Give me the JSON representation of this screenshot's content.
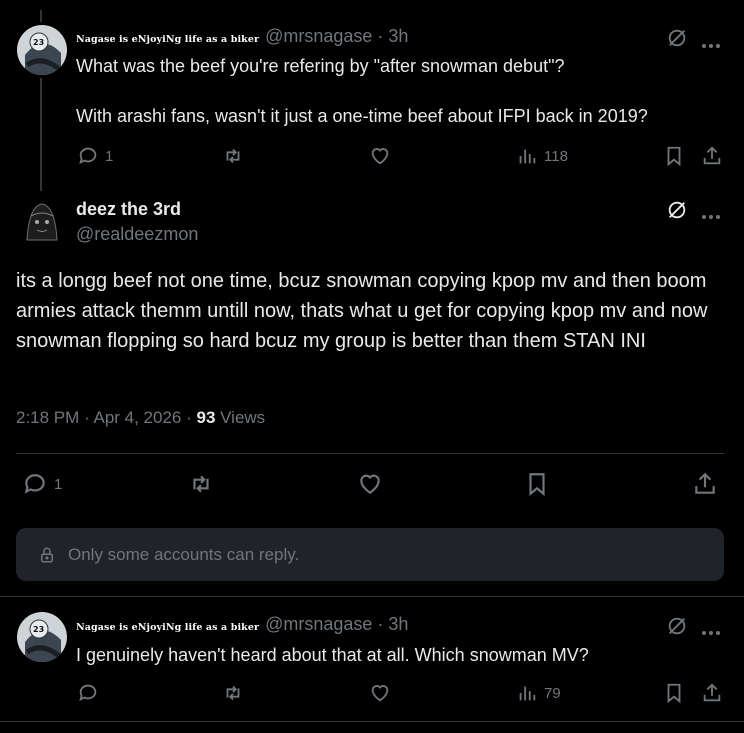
{
  "reply1": {
    "display_name": "Nagase is eNjoyiNg life as a biker",
    "handle": "@mrsnagase · 3h",
    "line1": "What was the beef you're refering by \"after snowman debut\"?",
    "line2": "With arashi fans, wasn't it just a one-time beef about IFPI back in 2019?",
    "replies": "1",
    "views": "118"
  },
  "main": {
    "display_name": "deez the 3rd",
    "handle": "@realdeezmon",
    "text": "its a longg beef not one time, bcuz snowman copying kpop mv and then boom armies attack themm untill now, thats what u get for copying kpop mv and now snowman flopping so hard bcuz my group is better than them STAN INI",
    "time": "2:18 PM · Apr 4, 2026 · ",
    "views_count": "93",
    "views_label": " Views",
    "replies": "1",
    "restricted_notice": "Only some accounts can reply."
  },
  "reply2": {
    "display_name": "Nagase is eNjoyiNg life as a biker",
    "handle": "@mrsnagase · 3h",
    "text": "I genuinely haven't heard about that at all. Which snowman MV?",
    "views": "79"
  },
  "icons": [
    "grok-icon",
    "more-icon",
    "reply-icon",
    "retweet-icon",
    "like-icon",
    "views-icon",
    "bookmark-icon",
    "share-icon",
    "lock-icon"
  ],
  "colors": {
    "background": "#000000",
    "text": "#e7e9ea",
    "muted": "#71767b",
    "divider": "#2f3336",
    "notice_bg": "#202327"
  }
}
